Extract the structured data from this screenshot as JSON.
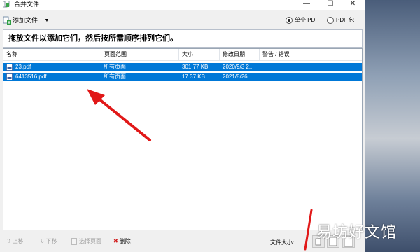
{
  "window": {
    "title": "合并文件"
  },
  "toolbar": {
    "add_file_label": "添加文件...",
    "radio_single": "单个 PDF",
    "radio_package": "PDF 包",
    "selected": "single"
  },
  "instruction": "拖放文件以添加它们，然后按所需顺序排列它们。",
  "table": {
    "columns": [
      "名称",
      "页面范围",
      "大小",
      "修改日期",
      "警告 / 错误"
    ],
    "rows": [
      {
        "name": "23.pdf",
        "range": "所有页面",
        "size": "301.77 KB",
        "date": "2020/9/3 2...",
        "warning": ""
      },
      {
        "name": "6413516.pdf",
        "range": "所有页面",
        "size": "17.37 KB",
        "date": "2021/8/26 ...",
        "warning": ""
      }
    ]
  },
  "bottom": {
    "move_up": "上移",
    "move_down": "下移",
    "select_pages": "选择页面",
    "delete": "删除",
    "file_size_label": "文件大小:"
  },
  "watermark": "易坊好文馆",
  "colors": {
    "selection": "#0078d7",
    "arrow": "#e11818"
  }
}
